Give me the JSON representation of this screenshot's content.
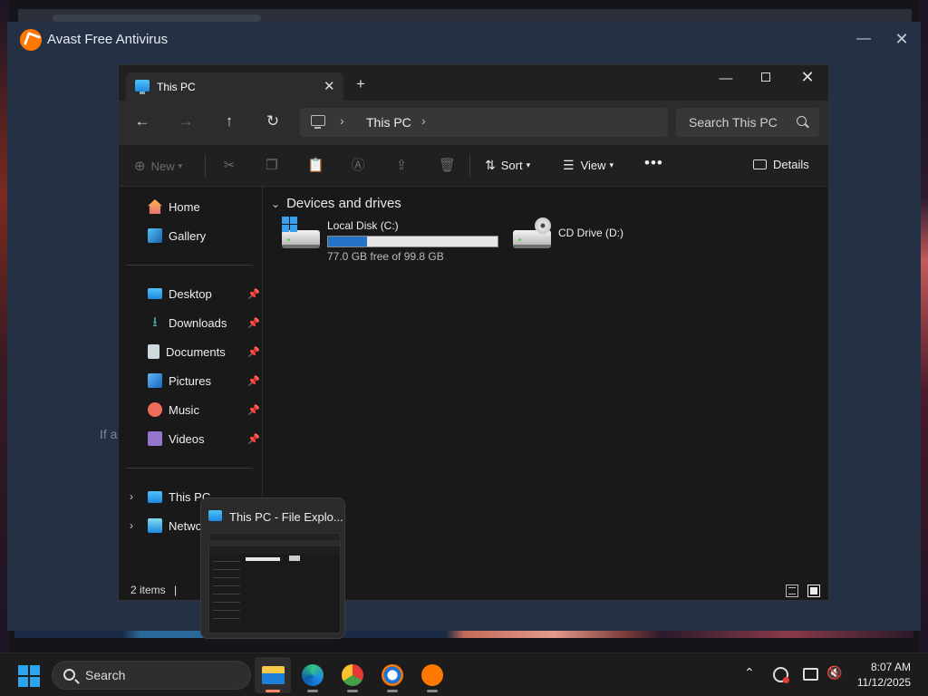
{
  "avast": {
    "title": "Avast Free Antivirus",
    "hint_text": "If a"
  },
  "explorer": {
    "tab_title": "This PC",
    "address": {
      "location": "This PC"
    },
    "search_placeholder": "Search This PC",
    "commands": {
      "new_label": "New",
      "sort_label": "Sort",
      "view_label": "View",
      "details_label": "Details"
    },
    "sidebar": {
      "top": [
        {
          "label": "Home",
          "icon": "home-icon"
        },
        {
          "label": "Gallery",
          "icon": "gallery-icon"
        }
      ],
      "pinned": [
        {
          "label": "Desktop",
          "icon": "desktop-icon"
        },
        {
          "label": "Downloads",
          "icon": "downloads-icon"
        },
        {
          "label": "Documents",
          "icon": "documents-icon"
        },
        {
          "label": "Pictures",
          "icon": "pictures-icon"
        },
        {
          "label": "Music",
          "icon": "music-icon"
        },
        {
          "label": "Videos",
          "icon": "videos-icon"
        }
      ],
      "tree": [
        {
          "label": "This PC",
          "icon": "this-pc-icon"
        },
        {
          "label": "Netwo",
          "icon": "network-icon"
        }
      ]
    },
    "group_title": "Devices and drives",
    "drives": [
      {
        "name": "Local Disk (C:)",
        "free_text": "77.0 GB free of 99.8 GB",
        "used_fraction": 0.228,
        "icon": "local-disk-icon"
      },
      {
        "name": "CD Drive (D:)",
        "icon": "cd-drive-icon"
      }
    ],
    "status": {
      "items_text": "2 items",
      "separator": "|"
    }
  },
  "preview": {
    "title": "This PC - File Explo..."
  },
  "taskbar": {
    "search_label": "Search",
    "apps": [
      {
        "name": "file-explorer-icon",
        "active": true
      },
      {
        "name": "edge-icon",
        "active": false
      },
      {
        "name": "chrome-beta-icon",
        "active": false
      },
      {
        "name": "avast-browser-icon",
        "active": false
      },
      {
        "name": "avast-antivirus-icon",
        "active": false
      }
    ],
    "clock": {
      "time": "8:07 AM",
      "date": "11/12/2025"
    }
  },
  "colors": {
    "accent": "#2673c6",
    "avast_orange": "#ff7800",
    "explorer_bg": "#191919"
  }
}
